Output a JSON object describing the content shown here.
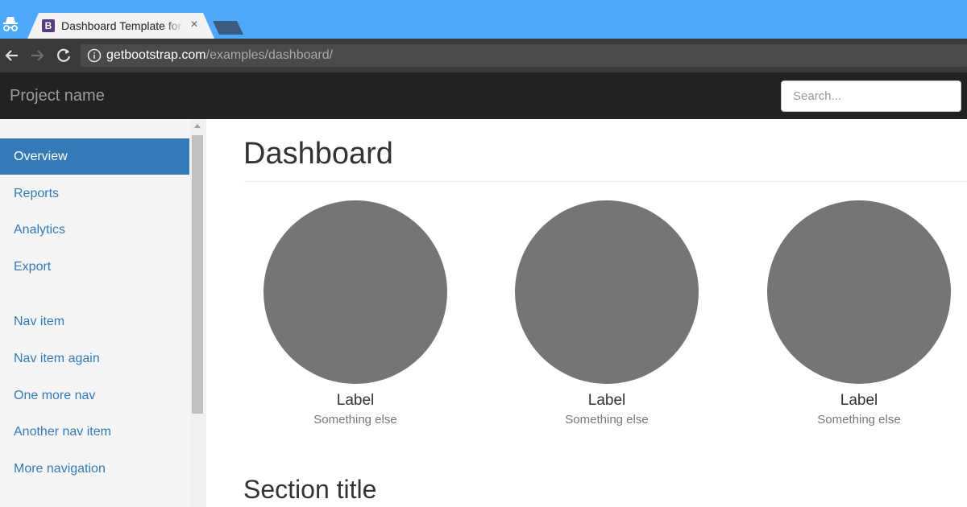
{
  "browser": {
    "tab_title": "Dashboard Template for",
    "tab_close": "×",
    "url_host": "getbootstrap.com",
    "url_path": "/examples/dashboard/"
  },
  "navbar": {
    "brand": "Project name",
    "search_placeholder": "Search..."
  },
  "sidebar": {
    "items": [
      {
        "label": "Overview",
        "active": true
      },
      {
        "label": "Reports"
      },
      {
        "label": "Analytics"
      },
      {
        "label": "Export"
      },
      {
        "label": "Nav item"
      },
      {
        "label": "Nav item again"
      },
      {
        "label": "One more nav"
      },
      {
        "label": "Another nav item"
      },
      {
        "label": "More navigation"
      }
    ]
  },
  "main": {
    "title": "Dashboard",
    "placeholders": [
      {
        "label": "Label",
        "sub": "Something else"
      },
      {
        "label": "Label",
        "sub": "Something else"
      },
      {
        "label": "Label",
        "sub": "Something else"
      }
    ],
    "section_title": "Section title"
  },
  "colors": {
    "chrome_tabstrip": "#4ea8fb",
    "navbar_bg": "#222222",
    "accent": "#337ab7",
    "placeholder_circle": "#767576"
  },
  "icons": {
    "incognito": "incognito-icon",
    "back": "back-arrow-icon",
    "forward": "forward-arrow-icon",
    "reload": "reload-icon",
    "info": "info-icon"
  }
}
